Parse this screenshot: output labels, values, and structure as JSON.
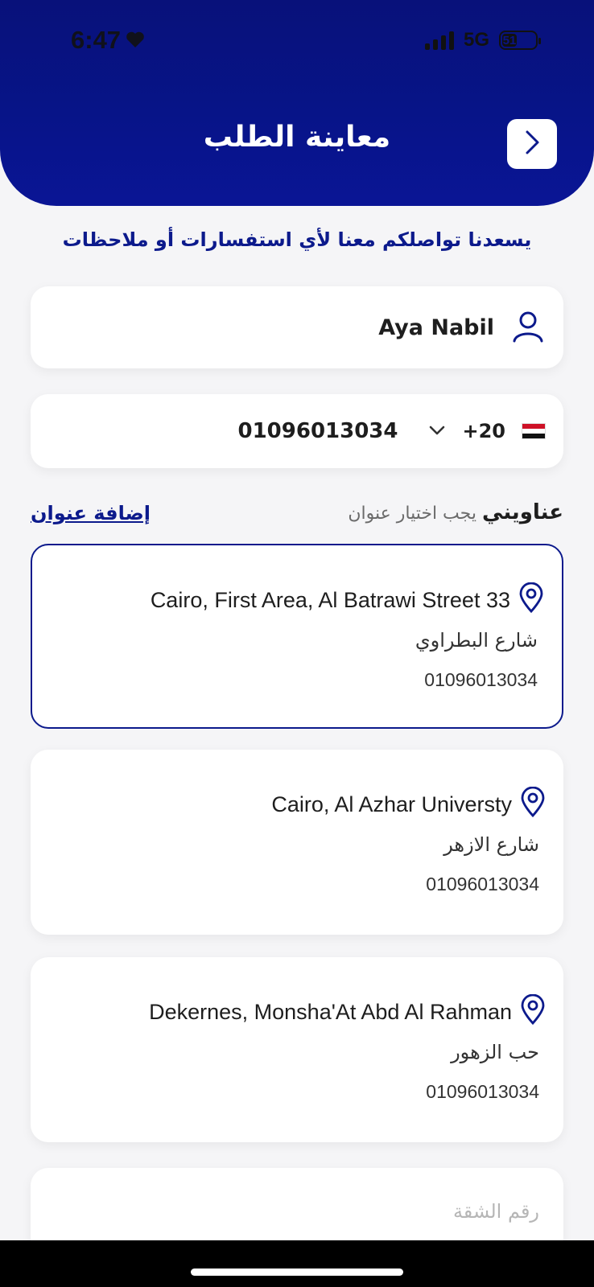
{
  "status_bar": {
    "time": "6:47",
    "network": "5G",
    "battery": "51"
  },
  "header": {
    "title": "معاينة الطلب"
  },
  "subtitle": "يسعدنا تواصلكم معنا لأي استفسارات أو ملاحظات",
  "user": {
    "name": "Aya Nabil"
  },
  "phone": {
    "country_code": "+20",
    "number": "01096013034"
  },
  "addresses_section": {
    "title": "عناويني",
    "hint": "يجب اختيار عنوان",
    "add_label": "إضافة عنوان"
  },
  "addresses": [
    {
      "line1": "Cairo, First Area, Al Batrawi Street 33",
      "street": "شارع البطراوي",
      "phone": "01096013034",
      "selected": true
    },
    {
      "line1": "Cairo, Al Azhar Universty",
      "street": "شارع الازهر",
      "phone": "01096013034",
      "selected": false
    },
    {
      "line1": "Dekernes, Monsha'At Abd Al Rahman",
      "street": "حب الزهور",
      "phone": "01096013034",
      "selected": false
    }
  ],
  "apartment": {
    "placeholder": "رقم الشقة"
  },
  "colors": {
    "brand": "#0c1a8c",
    "header_gradient_top": "#08117a",
    "background": "#f5f5f7"
  },
  "icons": [
    "heart-icon",
    "signal-icon",
    "battery-icon",
    "chevron-right-icon",
    "user-icon",
    "chevron-down-icon",
    "egypt-flag-icon",
    "location-pin-icon"
  ]
}
